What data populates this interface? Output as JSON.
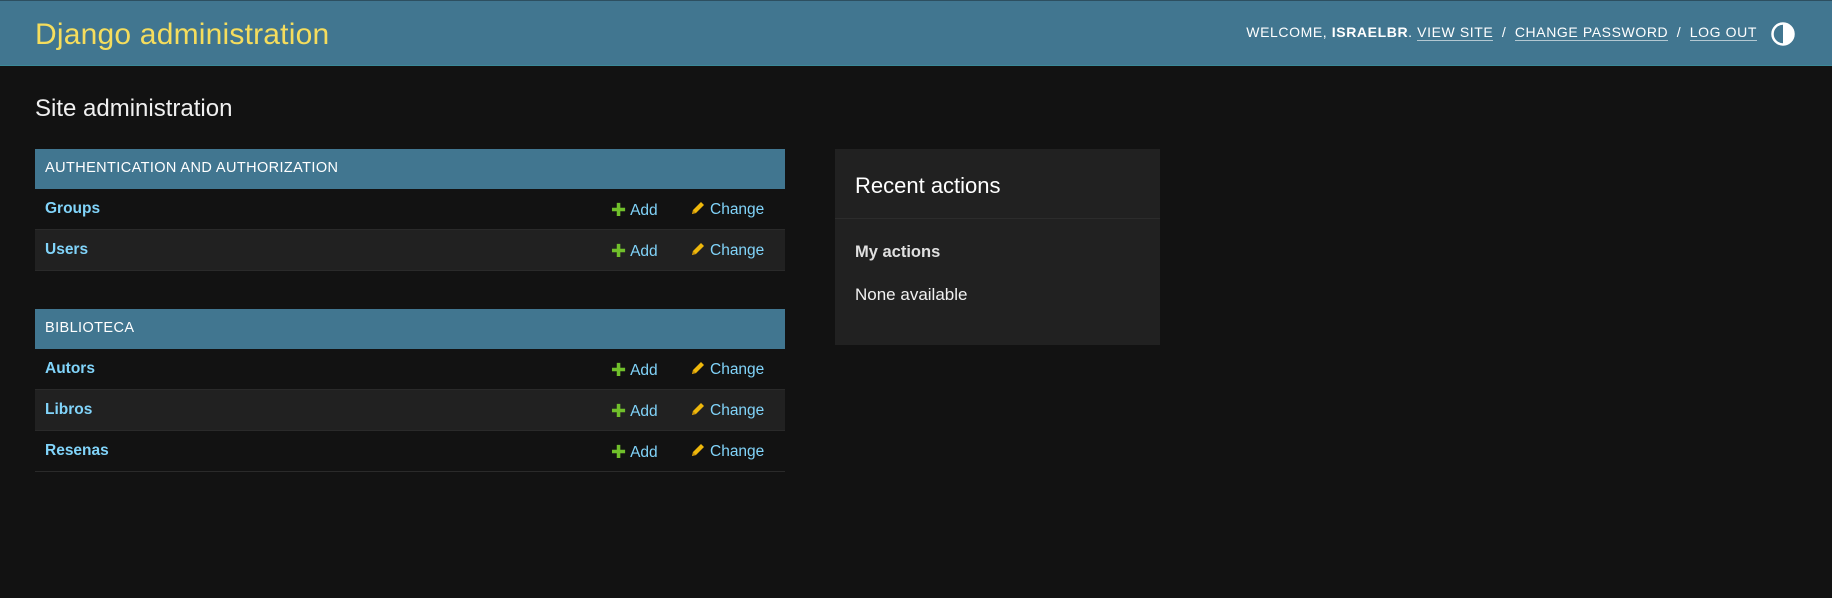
{
  "header": {
    "brand": "Django administration",
    "welcome_prefix": "WELCOME,",
    "username": "ISRAELBR",
    "welcome_suffix": ".",
    "links": {
      "view_site": "VIEW SITE",
      "change_password": "CHANGE PASSWORD",
      "log_out": "LOG OUT"
    },
    "separator": "/",
    "theme_icon": "half-circle-contrast-icon"
  },
  "main": {
    "title": "Site administration"
  },
  "modules": [
    {
      "caption": "AUTHENTICATION AND AUTHORIZATION",
      "models": [
        {
          "name": "Groups",
          "add": "Add",
          "change": "Change"
        },
        {
          "name": "Users",
          "add": "Add",
          "change": "Change"
        }
      ]
    },
    {
      "caption": "BIBLIOTECA",
      "models": [
        {
          "name": "Autors",
          "add": "Add",
          "change": "Change"
        },
        {
          "name": "Libros",
          "add": "Add",
          "change": "Change"
        },
        {
          "name": "Resenas",
          "add": "Add",
          "change": "Change"
        }
      ]
    }
  ],
  "recent_actions": {
    "title": "Recent actions",
    "subtitle": "My actions",
    "empty": "None available"
  },
  "colors": {
    "header_bg": "#417690",
    "brand": "#f5dd5d",
    "link": "#81d4fa",
    "add_icon": "#70bf2b",
    "change_icon": "#efb80b",
    "page_bg": "#121212"
  }
}
